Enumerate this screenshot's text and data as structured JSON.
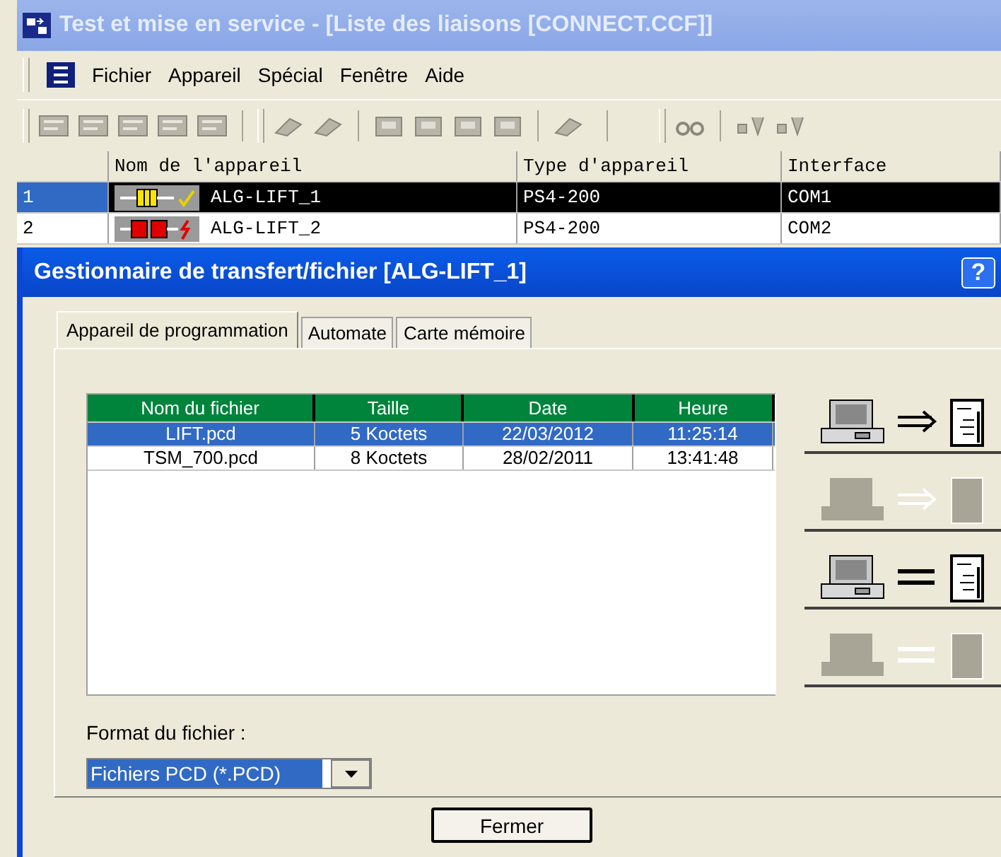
{
  "window": {
    "title": "Test et mise en service - [Liste des liaisons [CONNECT.CCF]]"
  },
  "menu": [
    "Fichier",
    "Appareil",
    "Spécial",
    "Fenêtre",
    "Aide"
  ],
  "connections": {
    "columns": [
      "Nom de l'appareil",
      "Type d'appareil",
      "Interface"
    ],
    "rows": [
      {
        "number": "1",
        "name": "ALG-LIFT_1",
        "type": "PS4-200",
        "interface": "COM1",
        "kind": "ok",
        "selected": true
      },
      {
        "number": "2",
        "name": "ALG-LIFT_2",
        "type": "PS4-200",
        "interface": "COM2",
        "kind": "fault",
        "selected": false
      }
    ]
  },
  "dialog": {
    "title": "Gestionnaire de transfert/fichier [ALG-LIFT_1]",
    "help": "?",
    "tabs": [
      {
        "label": "Appareil de programmation",
        "selected": true
      },
      {
        "label": "Automate",
        "selected": false
      },
      {
        "label": "Carte mémoire",
        "selected": false
      }
    ],
    "files": {
      "columns": [
        "Nom du fichier",
        "Taille",
        "Date",
        "Heure"
      ],
      "rows": [
        {
          "cells": [
            "LIFT.pcd",
            "5 Koctets",
            "22/03/2012",
            "11:25:14"
          ],
          "selected": true
        },
        {
          "cells": [
            "TSM_700.pcd",
            "8 Koctets",
            "28/02/2011",
            "13:41:48"
          ],
          "selected": false
        }
      ]
    },
    "actions": [
      {
        "kind": "transfer",
        "disabled": false
      },
      {
        "kind": "transfer",
        "disabled": true
      },
      {
        "kind": "compare",
        "disabled": false
      },
      {
        "kind": "compare",
        "disabled": true
      }
    ],
    "format_label": "Format du fichier :",
    "format_value": "Fichiers PCD (*.PCD)",
    "close": "Fermer"
  }
}
